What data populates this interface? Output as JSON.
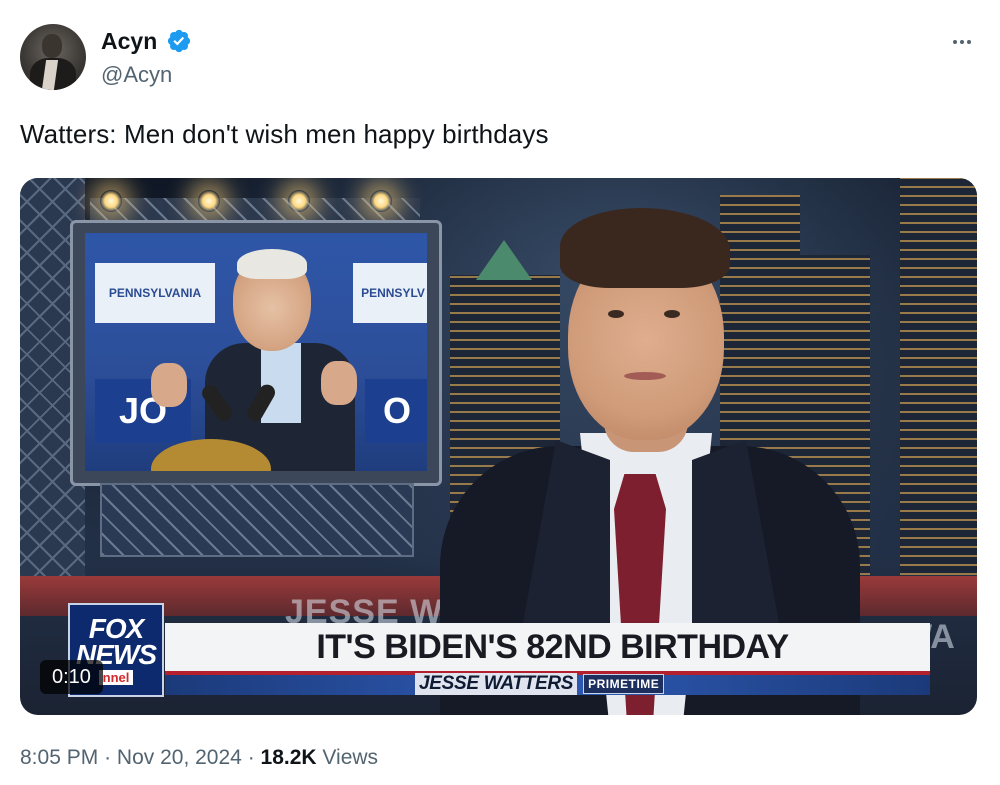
{
  "author": {
    "name": "Acyn",
    "handle": "@Acyn",
    "verified": true,
    "verified_color": "#1d9bf0"
  },
  "tweet": {
    "text": "Watters: Men don't wish men happy birthdays"
  },
  "media": {
    "type": "video",
    "duration": "0:10",
    "chyron": "IT'S BIDEN'S 82ND BIRTHDAY",
    "show_name": "JESSE WATTERS",
    "show_tag": "PRIMETIME",
    "network_logo_top": "FOX",
    "network_logo_mid": "NEWS",
    "network_logo_bottom": "nnel",
    "desk_sign_left": "JESSE W",
    "desk_sign_right": "WA",
    "screen_sign_left": "PENNSYLVANIA",
    "screen_sign_right": "PENNSYLV",
    "screen_sign_bottom_left": "JO",
    "screen_sign_bottom_right": "O"
  },
  "meta": {
    "time": "8:05 PM",
    "separator": "·",
    "date": "Nov 20, 2024",
    "views_count": "18.2K",
    "views_label": "Views"
  },
  "icons": {
    "more": "more-horizontal-icon",
    "verified": "verified-badge-icon"
  }
}
